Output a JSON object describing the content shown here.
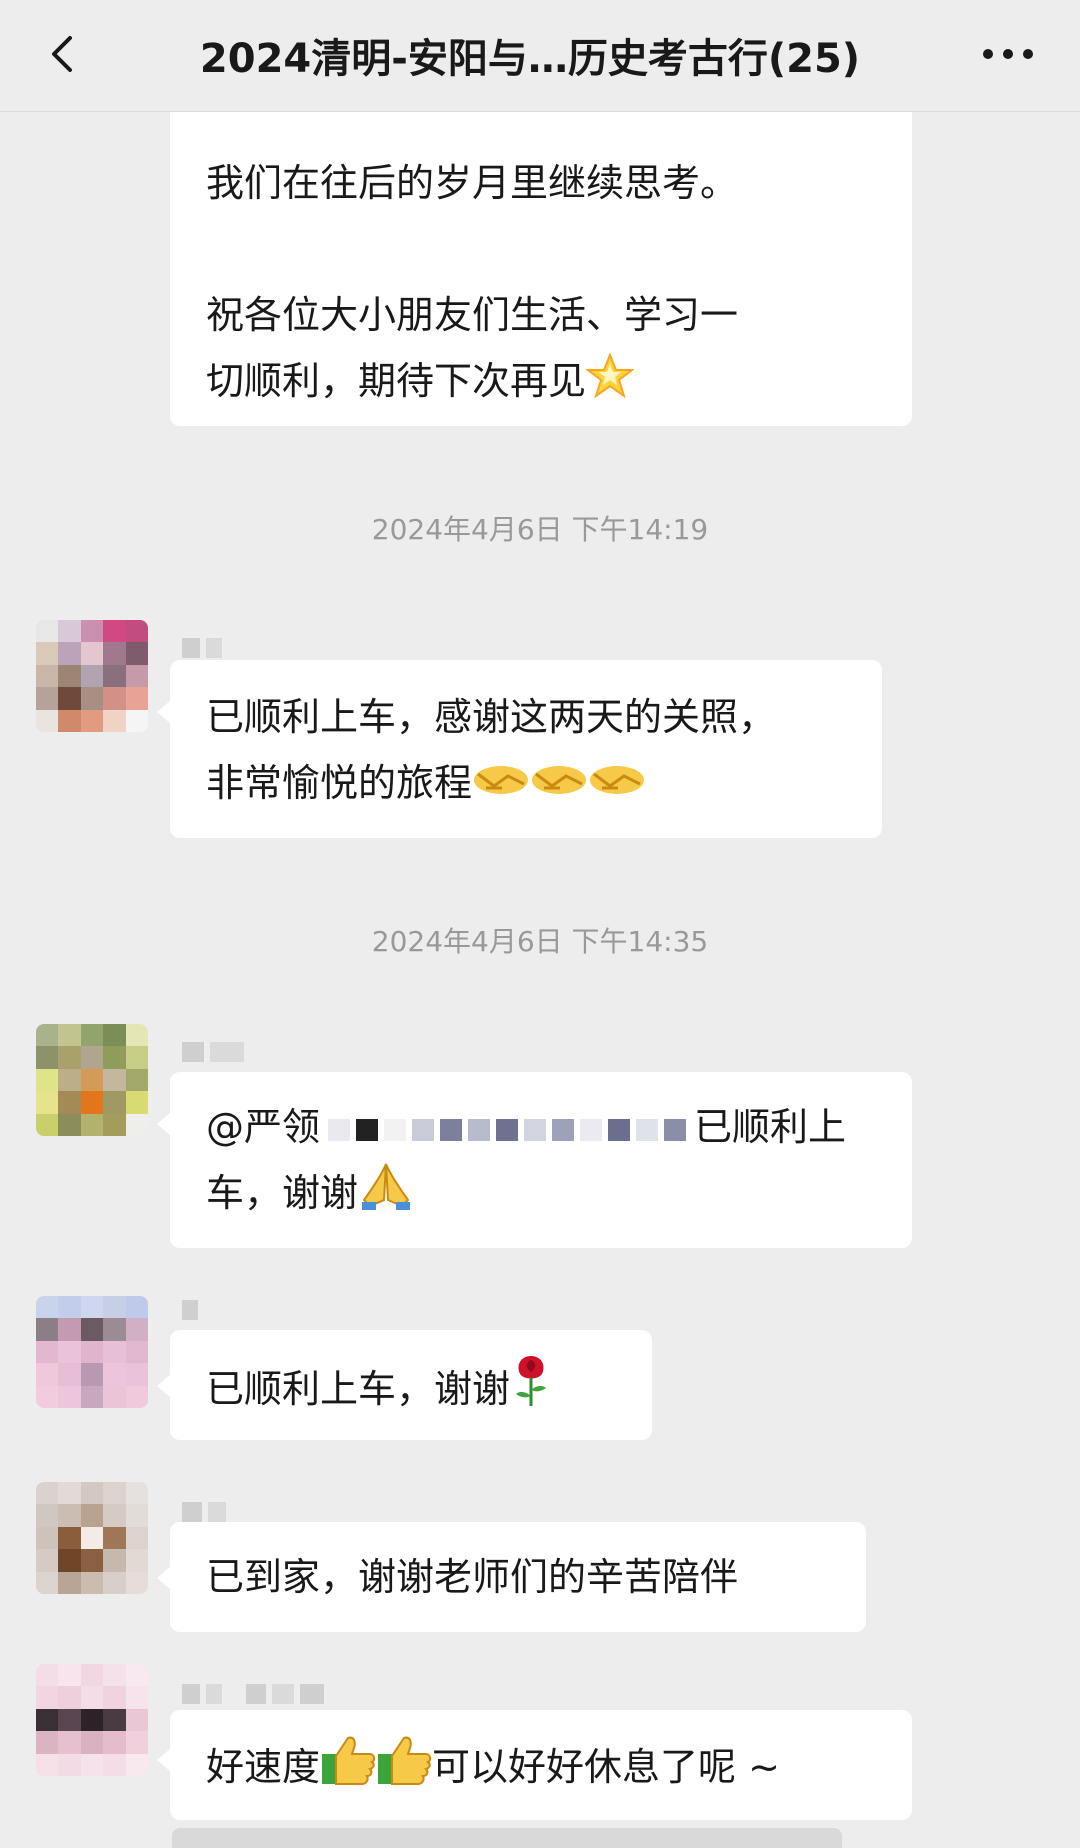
{
  "header": {
    "title": "2024清明-安阳与…历史考古行(25)"
  },
  "messages": {
    "m1": {
      "line1": "我们在往后的岁月里继续思考。",
      "line2": "祝各位大小朋友们生活、学习一",
      "line3": "切顺利，期待下次再见"
    },
    "ts1": "2024年4月6日 下午14:19",
    "m2": {
      "line1": "已顺利上车，感谢这两天的关照，",
      "line2": "非常愉悦的旅程"
    },
    "ts2": "2024年4月6日 下午14:35",
    "m3": {
      "mention": "@严领",
      "line1_end": "已顺利上",
      "line2": "车，谢谢"
    },
    "m4": {
      "text": "已顺利上车，谢谢"
    },
    "m5": {
      "text": "已到家，谢谢老师们的辛苦陪伴"
    },
    "m6": {
      "part1": "好速度",
      "part2": "可以好好休息了呢 ~"
    }
  },
  "icons": {
    "back": "chevron-left-icon",
    "more": "more-dots-icon",
    "star": "glowing-star-emoji",
    "handshake": "handshake-emoji",
    "pray": "folded-hands-emoji",
    "rose": "rose-emoji",
    "thumbs": "thumbs-up-emoji"
  },
  "colors": {
    "background": "#ededed",
    "bubble": "#ffffff",
    "timestamp": "#999999"
  }
}
